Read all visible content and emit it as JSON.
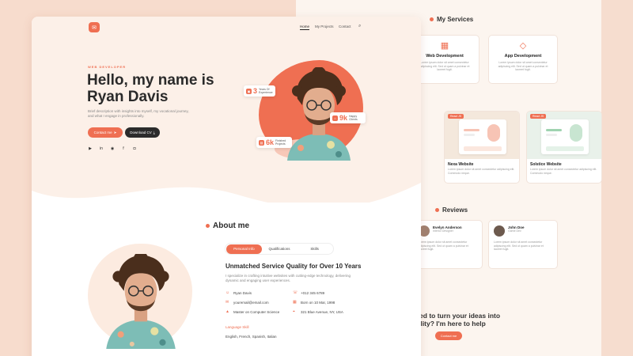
{
  "colors": {
    "accent": "#ef6f52",
    "dark": "#2b2b2b",
    "bg": "#fcf0e8"
  },
  "nav": {
    "logo_icon": "chat-bubble-icon",
    "items": [
      "Home",
      "My Projects",
      "Contact"
    ],
    "search_icon": "search-icon"
  },
  "hero": {
    "eyebrow": "WEB DEVELOPER",
    "title_line1": "Hello, my name is",
    "title_line2": "Ryan Davis",
    "description": "Brief description with insights into myself, my vocational journey, and what I engage in professionally.",
    "contact_button": "Contact me",
    "download_button": "Download CV",
    "socials": [
      "youtube-icon",
      "linkedin-icon",
      "github-icon",
      "facebook-icon",
      "instagram-icon"
    ],
    "stats": [
      {
        "value": "3",
        "label": "Years Of Experience",
        "icon": "briefcase-icon"
      },
      {
        "value": "9k",
        "label": "Happy Clients",
        "icon": "home-icon"
      },
      {
        "value": "6k",
        "label": "Finished Projects",
        "icon": "chart-icon"
      }
    ]
  },
  "about": {
    "title": "About me",
    "tabs": [
      "Personal Info",
      "Qualifications",
      "Skills"
    ],
    "active_tab": "Personal Info",
    "heading": "Unmatched Service Quality for Over 10 Years",
    "paragraph": "I specialize in crafting intuitive websites with cutting-edge technology, delivering dynamic and engaging user experiences.",
    "info": [
      {
        "icon": "user-icon",
        "text": "Ryan Davis"
      },
      {
        "icon": "phone-icon",
        "text": "+012 345 6789"
      },
      {
        "icon": "mail-icon",
        "text": "youremail@email.com"
      },
      {
        "icon": "calendar-icon",
        "text": "Born on 10 Mar, 1998"
      },
      {
        "icon": "graduation-icon",
        "text": "Master on Computer Science"
      },
      {
        "icon": "location-icon",
        "text": "321 Blue Avenue, NY, USA"
      }
    ],
    "language_label": "Language Skill",
    "languages": "English, French, Spanish, Italian"
  },
  "services": {
    "title": "My Services",
    "items": [
      {
        "title": "Web Development",
        "icon": "layout-icon",
        "desc": "Lorem ipsum dolor sit amet consectetur adipiscing elit. Sed ut quam a pulvinar et laoreet fugit."
      },
      {
        "title": "App Development",
        "icon": "diamond-icon",
        "desc": "Lorem ipsum dolor sit amet consectetur adipiscing elit. Sed ut quam a pulvinar et laoreet fugit."
      }
    ]
  },
  "projects": {
    "items": [
      {
        "badge": "React JS",
        "title": "Nexa Website",
        "desc": "Lorem ipsum dolor sit amet consectetur adipiscing elit. Commodo neque."
      },
      {
        "badge": "React JS",
        "title": "Solstice Website",
        "desc": "Lorem ipsum dolor sit amet consectetur adipiscing elit. Commodo neque."
      }
    ]
  },
  "reviews": {
    "title": "Reviews",
    "items": [
      {
        "name": "Evelyn Anderson",
        "role": "Interior Designer",
        "text": "Lorem ipsum dolor sit amet consectetur adipiscing elit. Sed ut quam a pulvinar et laoreet fugit."
      },
      {
        "name": "John Doe",
        "role": "Game Dev",
        "text": "Lorem ipsum dolor sit amet consectetur adipiscing elit. Sed ut quam a pulvinar et laoreet fugit."
      }
    ]
  },
  "cta": {
    "line1": "ared to turn your ideas into",
    "line2": "eality? I'm here to help",
    "button": "Contact me"
  }
}
